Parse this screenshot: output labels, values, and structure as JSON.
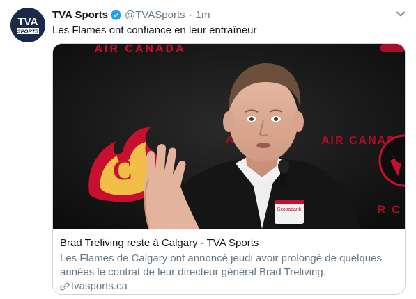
{
  "account": {
    "name": "TVA Sports",
    "handle": "@TVASports",
    "separator": "·",
    "time": "1m",
    "avatar_text_top": "TVA",
    "avatar_text_bottom": "SPORTS"
  },
  "tweet": {
    "text": "Les Flames ont confiance en leur entraîneur"
  },
  "card": {
    "image_banner_text": "AIR CANADA",
    "image_side_text_1": "A",
    "image_side_text_2": "R C",
    "image_side_text_3": "AIR CANADA",
    "image_mic_text": "Scotiabank",
    "title": "Brad Treliving reste à Calgary - TVA Sports",
    "description": "Les Flames de Calgary ont annoncé jeudi avoir prolongé de quelques années le contrat de leur directeur général Brad Treliving.",
    "domain": "tvasports.ca"
  },
  "icons": {
    "verified": "verified-badge-icon",
    "caret": "chevron-down-icon",
    "link": "link-icon"
  },
  "colors": {
    "verified_blue": "#1da1f2",
    "secondary_text": "#657786",
    "border": "#ccd6dd",
    "avatar_bg": "#1b2a4a",
    "flames_red": "#c8102e"
  }
}
